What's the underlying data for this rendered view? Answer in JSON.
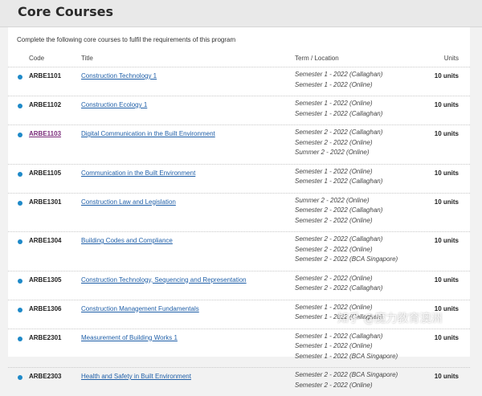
{
  "page": {
    "title": "Core Courses",
    "intro": "Complete the following core courses to fulfil the requirements of this program"
  },
  "table": {
    "headers": {
      "code": "Code",
      "title": "Title",
      "term": "Term / Location",
      "units": "Units"
    },
    "rows": [
      {
        "code": "ARBE1101",
        "title": "Construction Technology 1",
        "terms": [
          "Semester 1 - 2022 (Callaghan)",
          "Semester 1 - 2022 (Online)"
        ],
        "units": "10 units",
        "visited": false
      },
      {
        "code": "ARBE1102",
        "title": "Construction Ecology 1",
        "terms": [
          "Semester 1 - 2022 (Online)",
          "Semester 1 - 2022 (Callaghan)"
        ],
        "units": "10 units",
        "visited": false
      },
      {
        "code": "ARBE1103",
        "title": "Digital Communication in the Built Environment",
        "terms": [
          "Semester 2 - 2022 (Callaghan)",
          "Semester 2 - 2022 (Online)",
          "Summer 2 - 2022 (Online)"
        ],
        "units": "10 units",
        "visited": true
      },
      {
        "code": "ARBE1105",
        "title": "Communication in the Built Environment",
        "terms": [
          "Semester 1 - 2022 (Online)",
          "Semester 1 - 2022 (Callaghan)"
        ],
        "units": "10 units",
        "visited": false
      },
      {
        "code": "ARBE1301",
        "title": "Construction Law and Legislation",
        "terms": [
          "Summer 2 - 2022 (Online)",
          "Semester 2 - 2022 (Callaghan)",
          "Semester 2 - 2022 (Online)"
        ],
        "units": "10 units",
        "visited": false
      },
      {
        "code": "ARBE1304",
        "title": "Building Codes and Compliance",
        "terms": [
          "Semester 2 - 2022 (Callaghan)",
          "Semester 2 - 2022 (Online)",
          "Semester 2 - 2022 (BCA Singapore)"
        ],
        "units": "10 units",
        "visited": false
      },
      {
        "code": "ARBE1305",
        "title": "Construction Technology, Sequencing and Representation",
        "terms": [
          "Semester 2 - 2022 (Online)",
          "Semester 2 - 2022 (Callaghan)"
        ],
        "units": "10 units",
        "visited": false
      },
      {
        "code": "ARBE1306",
        "title": "Construction Management Fundamentals",
        "terms": [
          "Semester 1 - 2022 (Online)",
          "Semester 1 - 2022 (Callaghan)"
        ],
        "units": "10 units",
        "visited": false
      },
      {
        "code": "ARBE2301",
        "title": "Measurement of Building Works 1",
        "terms": [
          "Semester 1 - 2022 (Callaghan)",
          "Semester 1 - 2022 (Online)",
          "Semester 1 - 2022 (BCA Singapore)"
        ],
        "units": "10 units",
        "visited": false
      },
      {
        "code": "ARBE2303",
        "title": "Health and Safety in Built Environment",
        "terms": [
          "Semester 2 - 2022 (BCA Singapore)",
          "Semester 2 - 2022 (Online)"
        ],
        "units": "10 units",
        "visited": false
      }
    ]
  },
  "watermark": "知乎 @魔力教育澳洲"
}
